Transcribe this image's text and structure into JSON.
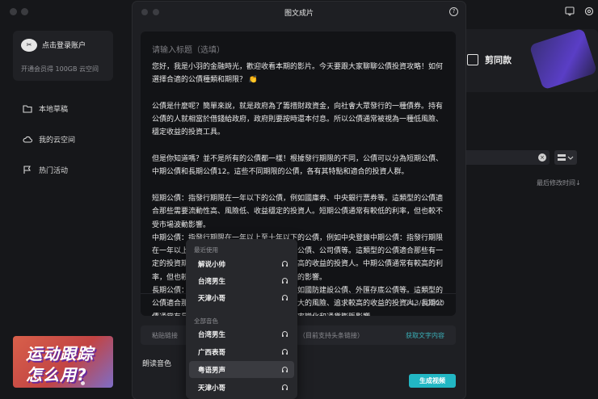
{
  "sidebar": {
    "login_title": "点击登录账户",
    "login_sub": "开通会员得 100GB 云空间",
    "login_icon": "jianying-logo-icon",
    "items": [
      {
        "label": "本地草稿",
        "icon": "folder-icon"
      },
      {
        "label": "我的云空间",
        "icon": "cloud-icon"
      },
      {
        "label": "热门活动",
        "icon": "flag-icon"
      }
    ],
    "promo_line1": "运动跟踪",
    "promo_line2": "怎么用?"
  },
  "right_panel": {
    "card_label": "剪同款",
    "sort_label": "最后修改时间↓"
  },
  "modal": {
    "title": "图文成片",
    "help": "?",
    "editor": {
      "title_placeholder": "请输入标题（选填）",
      "body": "您好，我是小羽的金融時光，歡迎收看本期的影片。今天要跟大家聊聊公債投資攻略！如何選擇合適的公債種類和期限？ 👏\n\n公債是什麼呢？簡單來說，就是政府為了籌措財政資金，向社會大眾發行的一種債券。持有公債的人就相當於借錢給政府，政府則要按時還本付息。所以公債通常被視為一種低風險、穩定收益的投資工具。\n\n但是你知道嗎？並不是所有的公債都一樣！根據發行期限的不同，公債可以分為短期公債、中期公債和長期公債12。這些不同期限的公債，各有其特點和適合的投資人群。\n\n短期公債：指發行期限在一年以下的公債，例如國庫券、中央銀行票券等。這類型的公債適合那些需要流動性高、風險低、收益穩定的投資人。短期公債通常有較低的利率，但也較不受市場波動影響。\n中期公債：指發行期限在一年以上至十年以下的公債，例如中央登錄中期公債：指發行期限在一年以上至十年以下的公債，例如中央登錄公債、公司債等。這類型的公債適合那些有一定的投資期限、願意承擔一定的風險、追求較高的收益的投資人。中期公債通常有較高的利率，但也較容易受到市場利率變化和通貨膨脹的影響。\n長期公債：指發行期限在十年以上的公債，例如國防建設公債、外匯存底公債等。這類型的公債適合那些有長期的投資目標、能夠承擔較大的風險、追求較高的收益的投資人。長期公債通常有最高的利率，但也最容易受到市場利率變化和通貨膨脹影響。\n那麼，如何選擇合適的公債種類和期限呢？這就要看你自己的投資目標、風險偏好和",
      "char_count": "743/20000"
    },
    "link_placeholder": "粘贴链接",
    "link_hint": "（目前支持头条链接）",
    "fetch_button": "获取文字内容",
    "voice_label": "朗读音色",
    "generate_button": "生成视频"
  },
  "voice_dropdown": {
    "recent_heading": "最近使用",
    "recent": [
      "解说小帅",
      "台湾男生",
      "天津小哥"
    ],
    "all_heading": "全部音色",
    "all": [
      "台湾男生",
      "广西表哥",
      "粤语男声",
      "天津小哥"
    ],
    "selected": "粤语男声",
    "item_icon": "headphones-icon"
  },
  "colors": {
    "accent": "#22b7c4",
    "modal_bg": "#1e1f23",
    "editor_bg": "#121316"
  }
}
